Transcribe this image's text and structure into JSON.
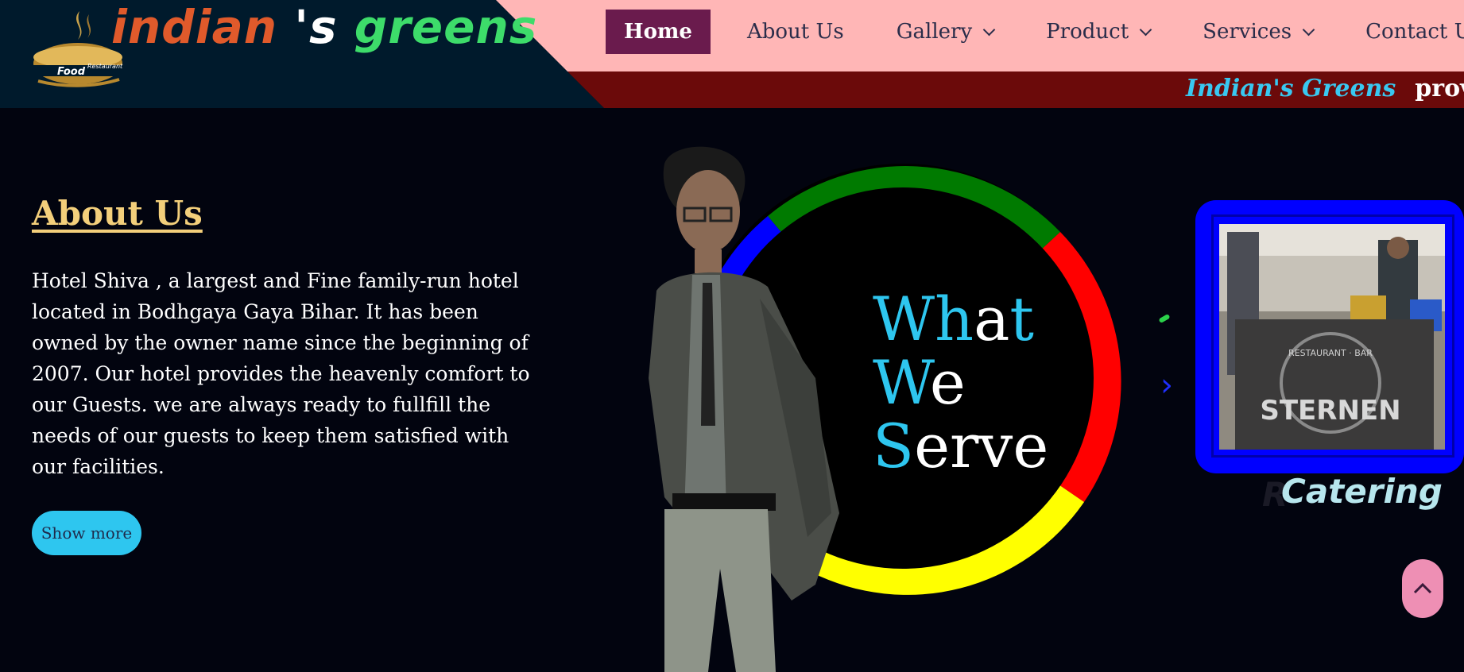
{
  "header": {
    "brand": {
      "part1": "indian",
      "part2": "'s",
      "part3": "greens"
    },
    "logo_text": {
      "line1": "Food",
      "line2": "Restaurant"
    },
    "nav": [
      {
        "label": "Home",
        "active": true
      },
      {
        "label": "About Us"
      },
      {
        "label": "Gallery",
        "dropdown": true
      },
      {
        "label": "Product",
        "dropdown": true
      },
      {
        "label": "Services",
        "dropdown": true
      },
      {
        "label": "Contact Us"
      }
    ],
    "marquee": {
      "brand": "Indian's Greens",
      "rest": "provides"
    }
  },
  "about": {
    "title": "About Us",
    "text": "Hotel Shiva , a largest and Fine family-run hotel located in Bodhgaya Gaya Bihar. It has been owned by the owner name since the beginning of 2007. Our hotel provides the heavenly comfort to our Guests. we are always ready to fullfill the needs of our guests to keep them satisfied with our facilities.",
    "button": "Show more"
  },
  "serve": {
    "line1": {
      "a": "Wh",
      "b": "a",
      "c": "t"
    },
    "line2": {
      "a": "W",
      "b": "e"
    },
    "line3": {
      "a": "S",
      "b": "erv",
      "c": "e"
    }
  },
  "carousel": {
    "caption": "Catering",
    "caption_ghost": "R",
    "photo_sign": "STERNEN",
    "photo_sign_small": "RESTAURANT · BAR"
  },
  "colors": {
    "ring_green": "#007a00",
    "ring_red": "#ff0000",
    "ring_yellow": "#ffff00",
    "ring_blue": "#0000ff",
    "accent_cyan": "#2ec6ef",
    "nav_bg": "#ffb6b6",
    "marquee_bg": "#6b0a0a",
    "active_nav": "#6a1b4d"
  },
  "icons": {
    "scroll_top": "chevron-up-icon",
    "next": "chevron-right-icon",
    "dropdown": "chevron-down-icon"
  }
}
